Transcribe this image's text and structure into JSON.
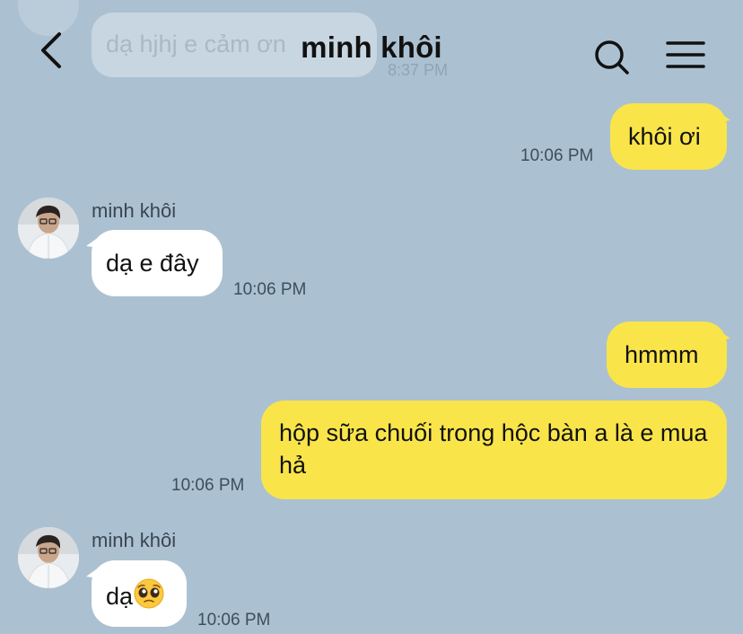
{
  "header": {
    "title": "minh khôi"
  },
  "previous_message": {
    "text": "dạ hjhj e cảm ơn",
    "time": "8:37 PM"
  },
  "messages": [
    {
      "direction": "out",
      "text": "khôi ơi",
      "time": "10:06 PM"
    },
    {
      "direction": "in",
      "sender": "minh khôi",
      "text": "dạ e đây",
      "time": "10:06 PM"
    },
    {
      "direction": "out",
      "text": "hmmm",
      "time": ""
    },
    {
      "direction": "out",
      "text": "hộp sữa chuối trong hộc bàn a là e mua hả",
      "time": "10:06 PM"
    },
    {
      "direction": "in",
      "sender": "minh khôi",
      "text": "dạ",
      "emoji": "pleading-face",
      "time": "10:06 PM"
    }
  ],
  "icons": [
    "back-icon",
    "search-icon",
    "menu-icon",
    "pleading-face-emoji"
  ],
  "colors": {
    "background": "#abc1d1",
    "outgoing_bubble": "#f9e54a",
    "incoming_bubble": "#ffffff"
  }
}
